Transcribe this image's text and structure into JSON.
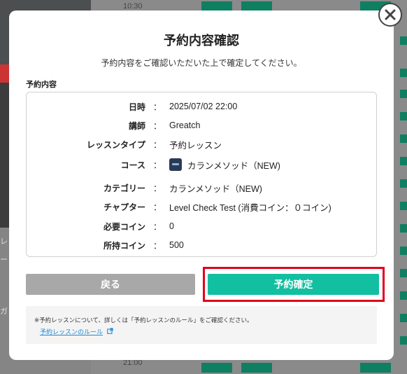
{
  "background": {
    "time_top": "10:30",
    "time_bottom": "21:00",
    "left_chars": [
      "レ",
      "ー",
      "ガ"
    ]
  },
  "modal": {
    "title": "予約内容確認",
    "subtitle": "予約内容をご確認いただいた上で確定してください。",
    "section_label": "予約内容",
    "details": [
      {
        "label": "日時",
        "value": "2025/07/02 22:00"
      },
      {
        "label": "講師",
        "value": "Greatch"
      },
      {
        "label": "レッスンタイプ",
        "value": "予約レッスン"
      },
      {
        "label": "コース",
        "value": "カランメソッド（NEW)",
        "icon": "course-thumbnail-icon"
      },
      {
        "label": "カテゴリー",
        "value": "カランメソッド（NEW)"
      },
      {
        "label": "チャプター",
        "value": "Level Check Test (消費コイン：０コイン)"
      },
      {
        "label": "必要コイン",
        "value": "0"
      },
      {
        "label": "所持コイン",
        "value": "500"
      }
    ],
    "colon": "：",
    "back_label": "戻る",
    "confirm_label": "予約確定",
    "notice_text": "※予約レッスンについて、詳しくは「予約レッスンのルール」をご確認ください。",
    "notice_link": "予約レッスンのルール"
  },
  "colors": {
    "confirm": "#12bfa0",
    "back": "#a8a8a8",
    "highlight": "#e0001a",
    "link": "#1e8ad3"
  }
}
